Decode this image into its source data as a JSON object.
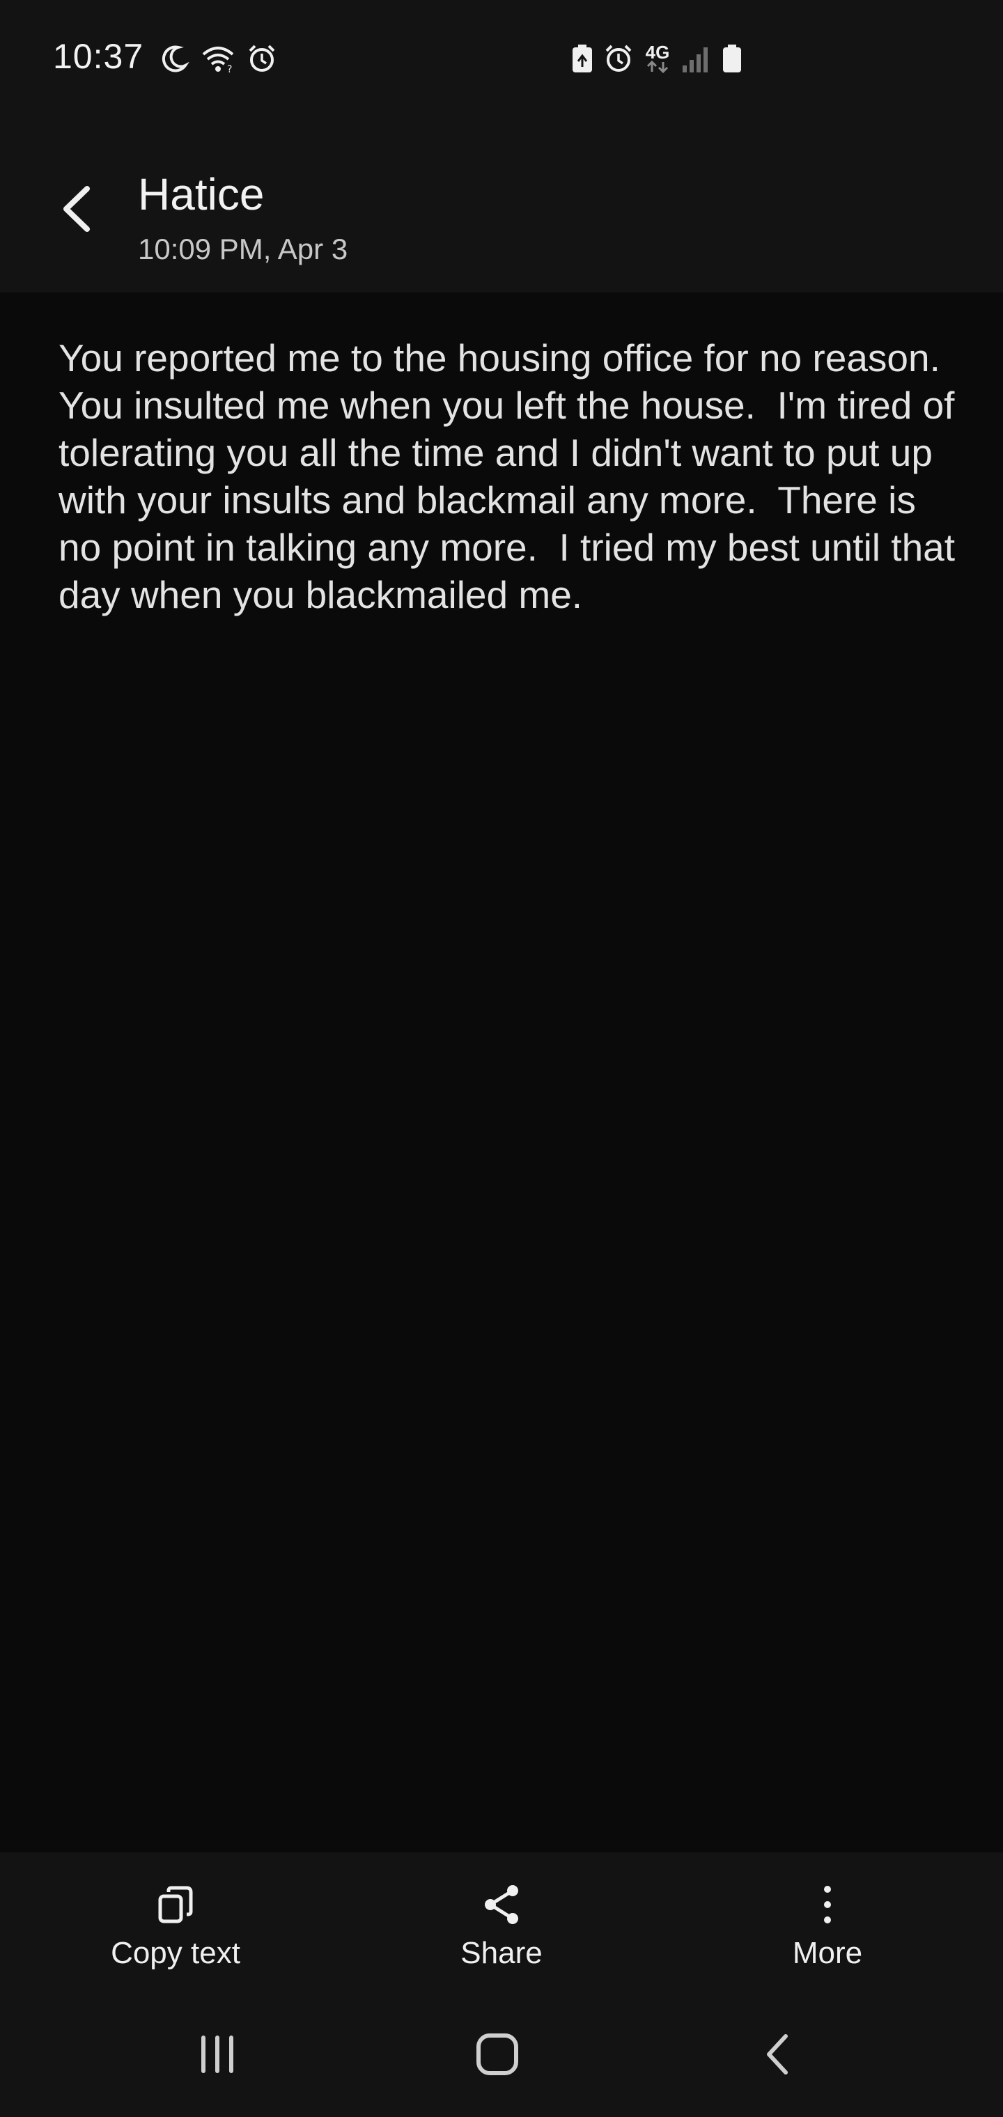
{
  "status_bar": {
    "time": "10:37",
    "left_icons": [
      "moon-icon",
      "wifi-icon",
      "alarm-icon"
    ],
    "right_icons": [
      "battery-saver-icon",
      "alarm-icon",
      "4g-lte-icon",
      "signal-icon",
      "battery-icon"
    ],
    "network_label": "4G"
  },
  "header": {
    "contact_name": "Hatice",
    "timestamp": "10:09 PM, Apr 3"
  },
  "message": {
    "text": "You reported me to the housing office for no reason.  You insulted me when you left the house.  I'm tired of tolerating you all the time and I didn't want to put up with your insults and blackmail any more.  There is no point in talking any more.  I tried my best until that day when you blackmailed me."
  },
  "actions": [
    {
      "label": "Copy text",
      "icon": "copy-icon"
    },
    {
      "label": "Share",
      "icon": "share-icon"
    },
    {
      "label": "More",
      "icon": "more-vertical-icon"
    }
  ],
  "nav": [
    "recent-apps-icon",
    "home-icon",
    "back-icon"
  ]
}
